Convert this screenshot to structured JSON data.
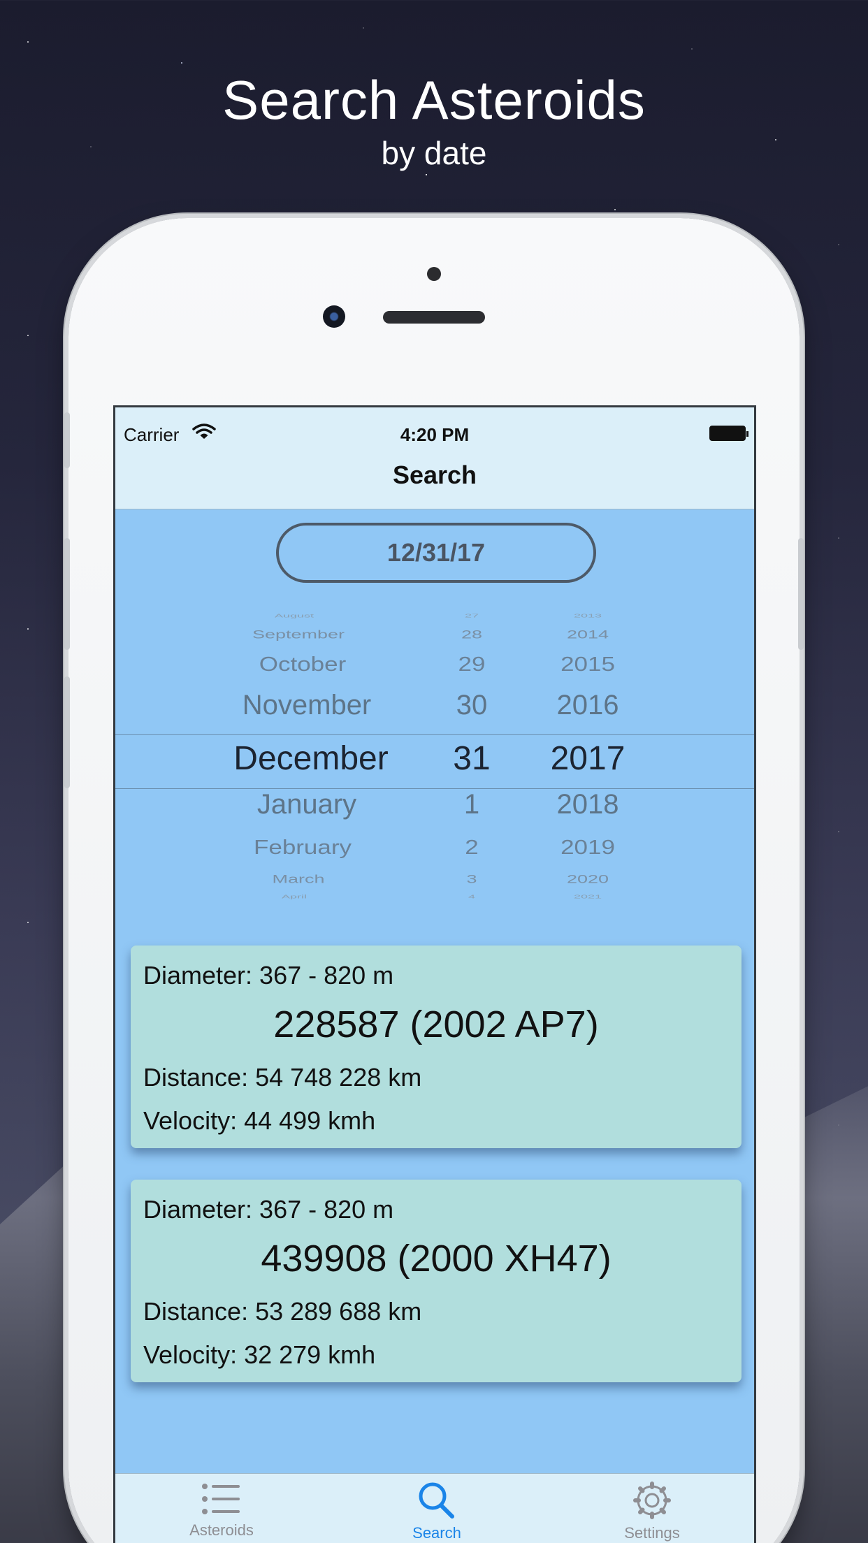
{
  "hero": {
    "title": "Search Asteroids",
    "subtitle": "by date"
  },
  "status_bar": {
    "carrier": "Carrier",
    "time": "4:20 PM"
  },
  "nav": {
    "title": "Search"
  },
  "date_field": {
    "value": "12/31/17"
  },
  "picker": {
    "rows": [
      {
        "month": "August",
        "day": "27",
        "year": "2013"
      },
      {
        "month": "September",
        "day": "28",
        "year": "2014"
      },
      {
        "month": "October",
        "day": "29",
        "year": "2015"
      },
      {
        "month": "November",
        "day": "30",
        "year": "2016"
      },
      {
        "month": "December",
        "day": "31",
        "year": "2017"
      },
      {
        "month": "January",
        "day": "1",
        "year": "2018"
      },
      {
        "month": "February",
        "day": "2",
        "year": "2019"
      },
      {
        "month": "March",
        "day": "3",
        "year": "2020"
      },
      {
        "month": "April",
        "day": "4",
        "year": "2021"
      }
    ],
    "selected_index": 4
  },
  "results": [
    {
      "diameter": "Diameter: 367 - 820 m",
      "name": "228587 (2002 AP7)",
      "distance": "Distance: 54 748 228 km",
      "velocity": "Velocity: 44 499 kmh"
    },
    {
      "diameter": "Diameter: 367 - 820 m",
      "name": "439908 (2000 XH47)",
      "distance": "Distance: 53 289 688 km",
      "velocity": "Velocity: 32 279 kmh"
    }
  ],
  "tabbar": {
    "tabs": [
      {
        "label": "Asteroids",
        "icon": "list-icon"
      },
      {
        "label": "Search",
        "icon": "search-icon",
        "active": true
      },
      {
        "label": "Settings",
        "icon": "gear-icon"
      }
    ]
  },
  "colors": {
    "accent": "#1a84e8",
    "screen_bg": "#90c7f5",
    "bar_bg": "#dbeff9",
    "card_bg": "#b1dedd",
    "inactive_tab": "#8e8e93"
  }
}
